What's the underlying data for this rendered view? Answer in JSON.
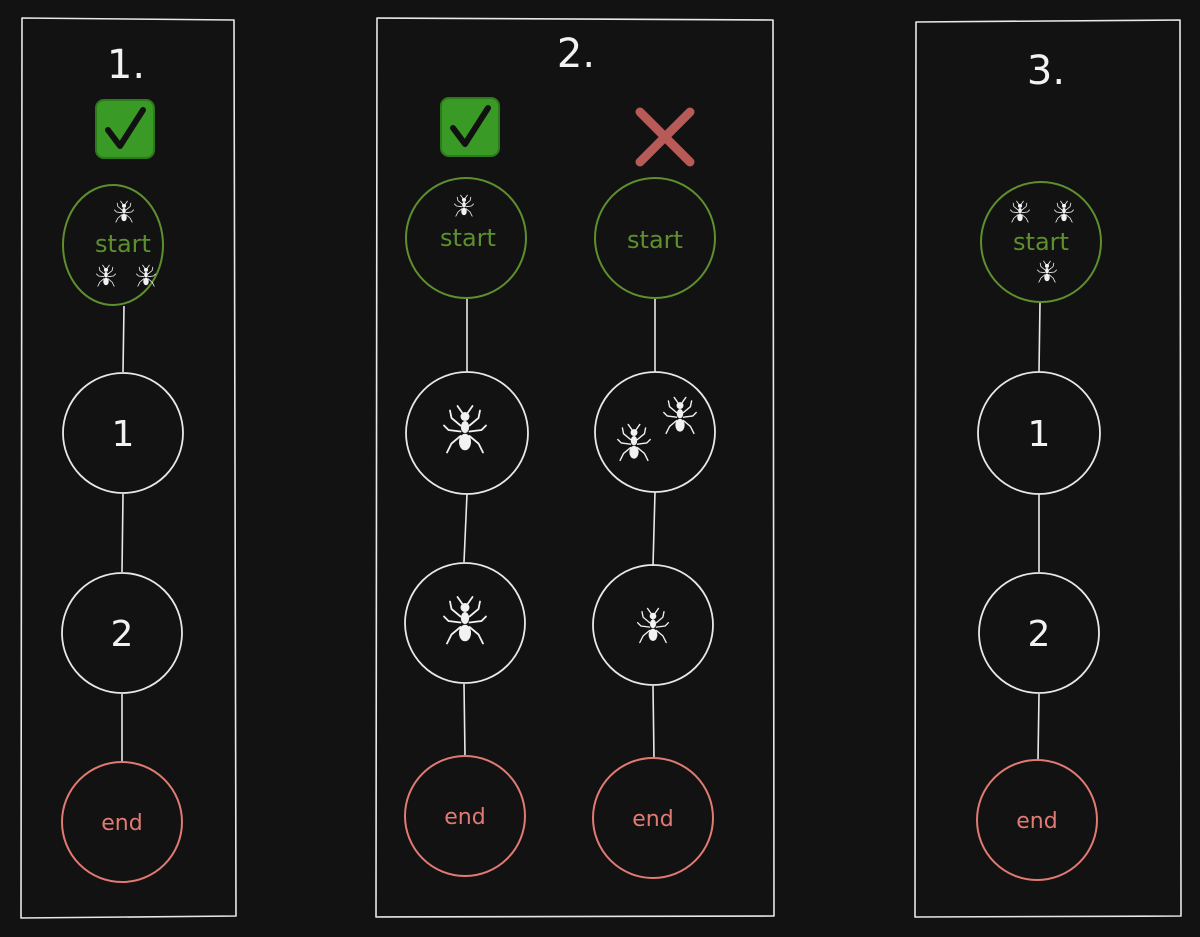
{
  "colors": {
    "background": "#121212",
    "stroke": "#e8e8e8",
    "start": "#5e8f2e",
    "end": "#e07a72",
    "check_fill": "#3a9a26",
    "check_border": "#2c7a1c",
    "cross": "#b85a58",
    "ant": "#f2f2f2"
  },
  "icons": {
    "ant": "ant-icon",
    "check": "check-icon",
    "cross": "cross-icon"
  },
  "panels": [
    {
      "label": "1.",
      "paths": [
        {
          "status": "check",
          "nodes": [
            {
              "kind": "start",
              "label": "start",
              "ants": 3
            },
            {
              "kind": "mid",
              "label": "1",
              "ants": 0
            },
            {
              "kind": "mid",
              "label": "2",
              "ants": 0
            },
            {
              "kind": "end",
              "label": "end",
              "ants": 0
            }
          ]
        }
      ]
    },
    {
      "label": "2.",
      "paths": [
        {
          "status": "check",
          "nodes": [
            {
              "kind": "start",
              "label": "start",
              "ants": 1
            },
            {
              "kind": "mid",
              "label": "",
              "ants": 1
            },
            {
              "kind": "mid",
              "label": "",
              "ants": 1
            },
            {
              "kind": "end",
              "label": "end",
              "ants": 0
            }
          ]
        },
        {
          "status": "cross",
          "nodes": [
            {
              "kind": "start",
              "label": "start",
              "ants": 0
            },
            {
              "kind": "mid",
              "label": "",
              "ants": 2
            },
            {
              "kind": "mid",
              "label": "",
              "ants": 1
            },
            {
              "kind": "end",
              "label": "end",
              "ants": 0
            }
          ]
        }
      ]
    },
    {
      "label": "3.",
      "paths": [
        {
          "status": "none",
          "nodes": [
            {
              "kind": "start",
              "label": "start",
              "ants": 3
            },
            {
              "kind": "mid",
              "label": "1",
              "ants": 0
            },
            {
              "kind": "mid",
              "label": "2",
              "ants": 0
            },
            {
              "kind": "end",
              "label": "end",
              "ants": 0
            }
          ]
        }
      ]
    }
  ]
}
